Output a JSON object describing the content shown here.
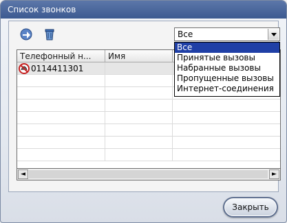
{
  "window": {
    "title": "Список звонков"
  },
  "toolbar": {
    "export_icon": "export-arrow-icon",
    "delete_icon": "trash-icon"
  },
  "grid": {
    "columns": [
      "Телефонный н...",
      "Имя",
      ""
    ],
    "rows": [
      {
        "phone": "0114411301",
        "name": "",
        "icon": "missed-call-icon",
        "selected": true
      }
    ]
  },
  "filter": {
    "selected": "Все",
    "options": [
      "Все",
      "Принятые вызовы",
      "Набранные вызовы",
      "Пропущенные вызовы",
      "Интернет-соединения"
    ],
    "highlighted_index": 0
  },
  "buttons": {
    "close_label": "Закрыть"
  },
  "colors": {
    "title_bar": "#3c5a91",
    "highlight": "#1f3fa6"
  }
}
